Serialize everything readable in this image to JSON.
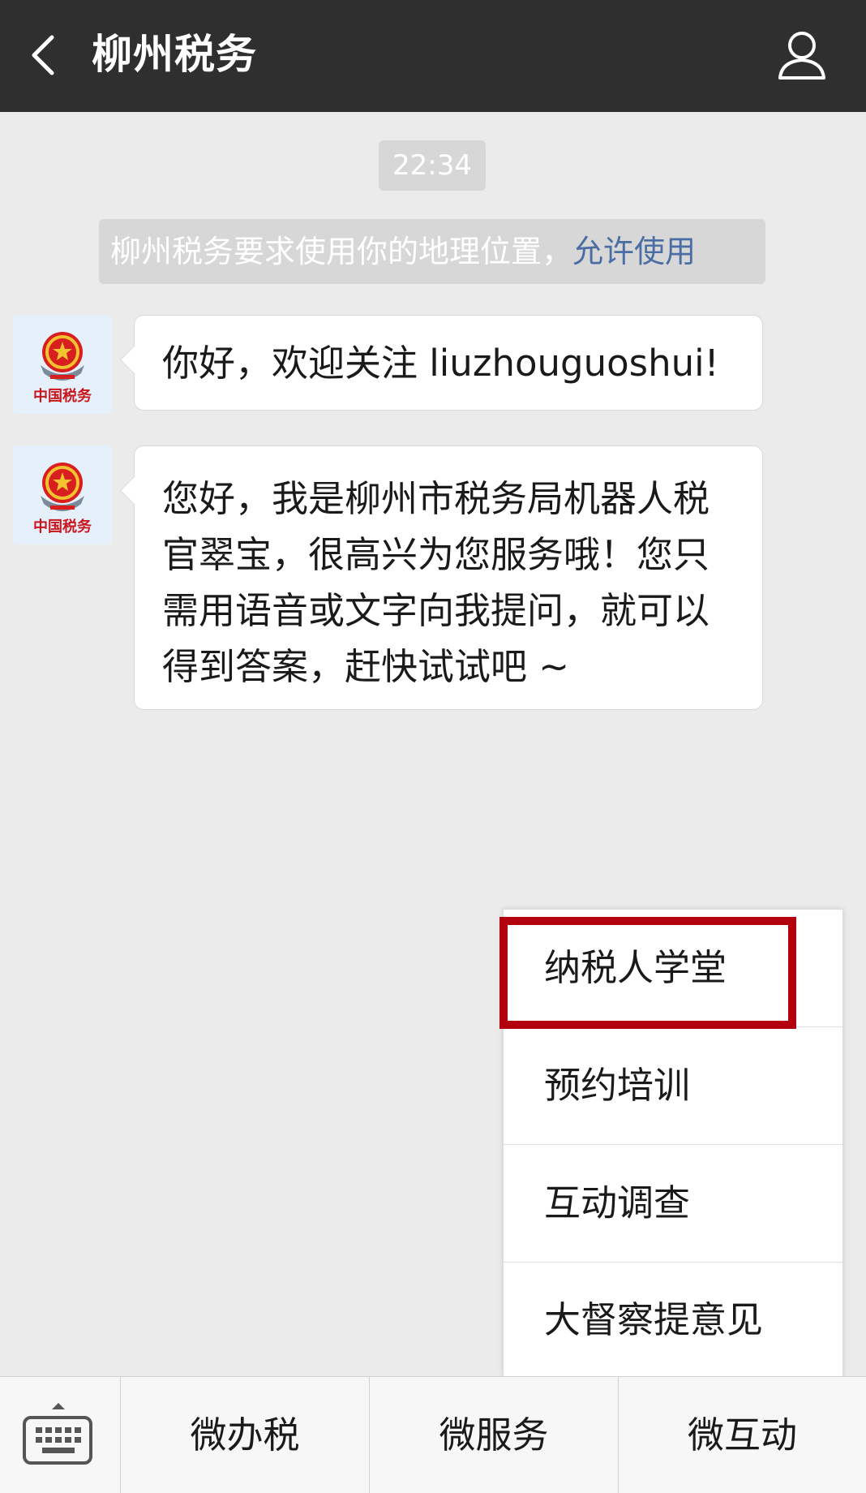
{
  "header": {
    "title": "柳州税务",
    "back_icon": "chevron-left-icon",
    "profile_icon": "user-profile-icon",
    "background": "#2f2f2f"
  },
  "chat": {
    "timestamp": "22:34",
    "location_request": {
      "text": "柳州税务要求使用你的地理位置，",
      "action": "允许使用",
      "action_color": "#4a6ea3"
    },
    "messages": [
      {
        "sender_icon": "tax-bureau-emblem-icon",
        "text": "你好，欢迎关注 liuzhouguoshui!"
      },
      {
        "sender_icon": "tax-bureau-emblem-icon",
        "text": "您好，我是柳州市税务局机器人税官翠宝，很高兴为您服务哦！您只需用语音或文字向我提问，就可以得到答案，赶快试试吧 ~"
      }
    ],
    "avatar_caption": "中国税务"
  },
  "popup_menu": {
    "items": [
      {
        "label": "纳税人学堂",
        "highlighted": true
      },
      {
        "label": "预约培训"
      },
      {
        "label": "互动调查"
      },
      {
        "label": "大督察提意见"
      }
    ],
    "highlight_color": "#b3000e"
  },
  "bottom_menu": {
    "keyboard_icon": "keyboard-icon",
    "buttons": [
      {
        "label": "微办税"
      },
      {
        "label": "微服务"
      },
      {
        "label": "微互动"
      }
    ]
  }
}
